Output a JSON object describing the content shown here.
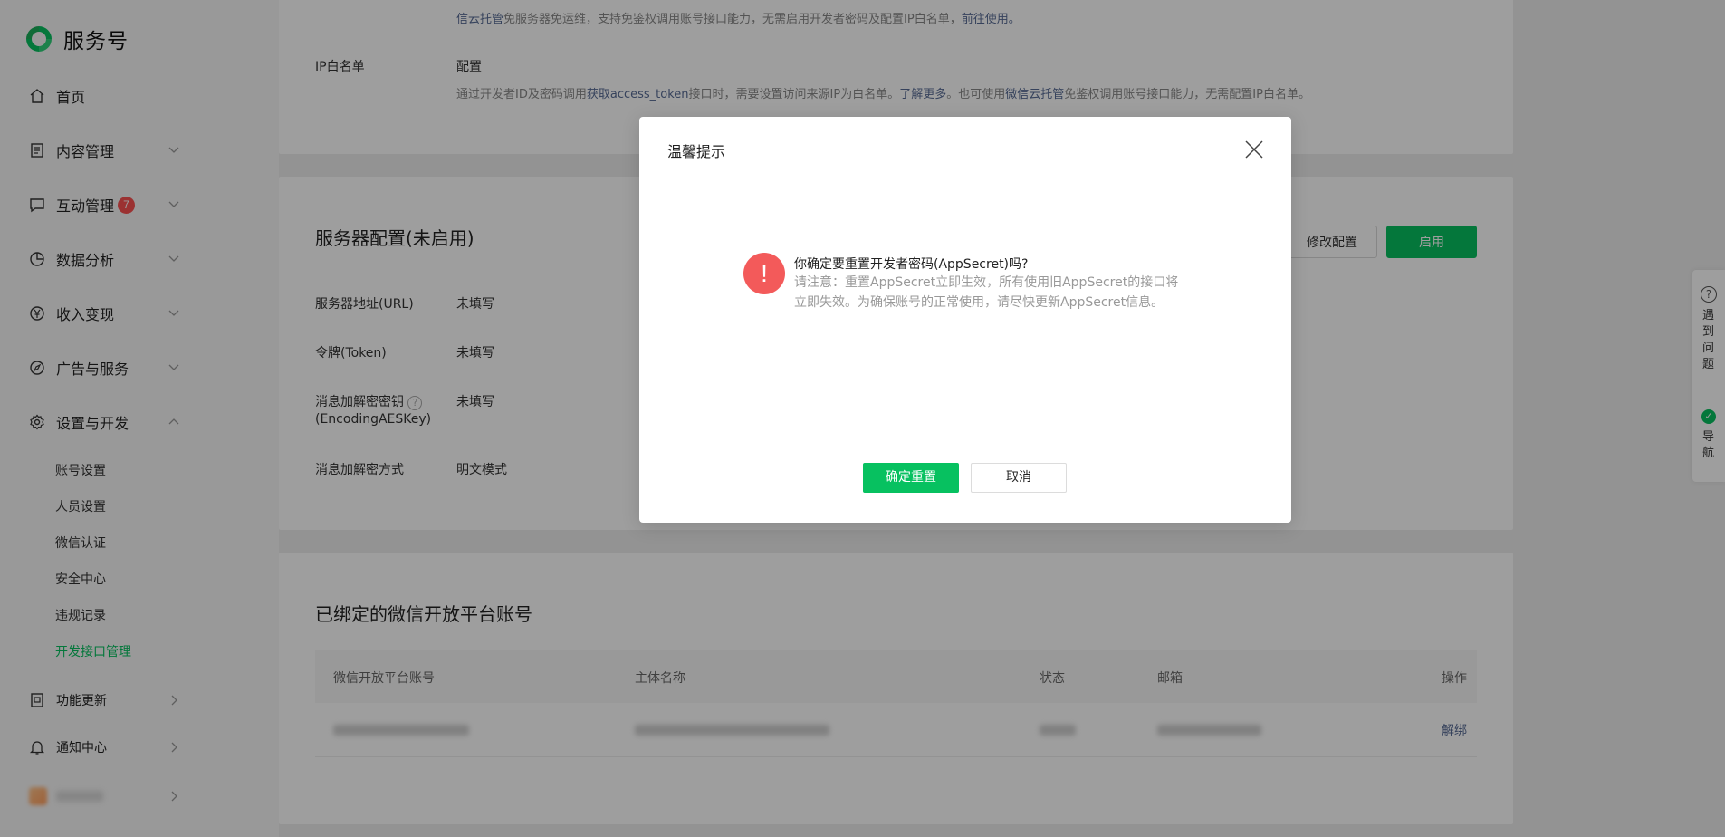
{
  "app": {
    "title": "服务号"
  },
  "sidebar": {
    "items": [
      {
        "label": "首页",
        "icon": "home-icon"
      },
      {
        "label": "内容管理",
        "icon": "document-icon"
      },
      {
        "label": "互动管理",
        "icon": "chat-icon",
        "badge": "7"
      },
      {
        "label": "数据分析",
        "icon": "pie-chart-icon"
      },
      {
        "label": "收入变现",
        "icon": "yen-icon"
      },
      {
        "label": "广告与服务",
        "icon": "compass-icon"
      },
      {
        "label": "设置与开发",
        "icon": "gear-icon"
      },
      {
        "label": "功能更新",
        "icon": "update-icon"
      },
      {
        "label": "通知中心",
        "icon": "bell-icon"
      }
    ],
    "sub_items": [
      {
        "label": "账号设置"
      },
      {
        "label": "人员设置"
      },
      {
        "label": "微信认证"
      },
      {
        "label": "安全中心"
      },
      {
        "label": "违规记录"
      },
      {
        "label": "开发接口管理"
      }
    ]
  },
  "content": {
    "top_text_line1_part1": "",
    "top_text_line2_link": "信云托管",
    "top_text_line2": "免服务器免运维，支持免鉴权调用账号接口能力，无需启用开发者密码及配置IP白名单，",
    "top_text_line2_link2": "前往使用。",
    "ip_whitelist": {
      "label": "IP白名单",
      "link": "配置",
      "desc_1": "通过开发者ID及密码调用",
      "desc_link1": "获取access_token",
      "desc_2": "接口时，需要设置访问来源IP为白名单。",
      "desc_link2": "了解更多",
      "desc_3": "。也可使用",
      "desc_link3": "微信云托管",
      "desc_4": "免鉴权调用账号接口能力，无需配置IP白名单。"
    },
    "server": {
      "title": "服务器配置(未启用)",
      "edit_button": "修改配置",
      "enable_button": "启用",
      "fields": [
        {
          "label": "服务器地址(URL)",
          "value": "未填写"
        },
        {
          "label": "令牌(Token)",
          "value": "未填写"
        },
        {
          "label": "消息加解密密钥",
          "label2": "(EncodingAESKey)",
          "value": "未填写"
        },
        {
          "label": "消息加解密方式",
          "value": "明文模式"
        }
      ]
    },
    "bound": {
      "title": "已绑定的微信开放平台账号",
      "columns": [
        "微信开放平台账号",
        "主体名称",
        "状态",
        "邮箱",
        "操作"
      ],
      "row_action": "解绑"
    }
  },
  "helper": {
    "problem": "遇到问题",
    "nav": "导航"
  },
  "dialog": {
    "title": "温馨提示",
    "message": "你确定要重置开发者密码(AppSecret)吗?",
    "note": "请注意：重置AppSecret立即生效，所有使用旧AppSecret的接口将立即失效。为确保账号的正常使用，请尽快更新AppSecret信息。",
    "confirm": "确定重置",
    "cancel": "取消",
    "icon_glyph": "!"
  },
  "colors": {
    "brand": "#07c160",
    "warning": "#f35a5a",
    "badge": "#fa5151",
    "link": "#576b95"
  }
}
